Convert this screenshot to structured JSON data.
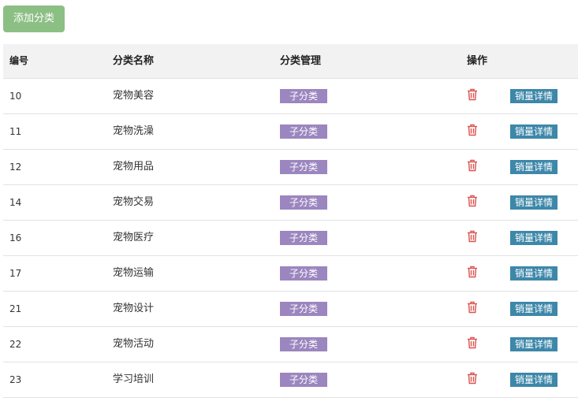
{
  "toolbar": {
    "add_label": "添加分类"
  },
  "table": {
    "headers": {
      "id": "编号",
      "name": "分类名称",
      "manage": "分类管理",
      "op": "操作"
    },
    "rows": [
      {
        "id": "10",
        "name": "宠物美容",
        "sub_label": "子分类",
        "sales_label": "销量详情"
      },
      {
        "id": "11",
        "name": "宠物洗澡",
        "sub_label": "子分类",
        "sales_label": "销量详情"
      },
      {
        "id": "12",
        "name": "宠物用品",
        "sub_label": "子分类",
        "sales_label": "销量详情"
      },
      {
        "id": "14",
        "name": "宠物交易",
        "sub_label": "子分类",
        "sales_label": "销量详情"
      },
      {
        "id": "16",
        "name": "宠物医疗",
        "sub_label": "子分类",
        "sales_label": "销量详情"
      },
      {
        "id": "17",
        "name": "宠物运输",
        "sub_label": "子分类",
        "sales_label": "销量详情"
      },
      {
        "id": "21",
        "name": "宠物设计",
        "sub_label": "子分类",
        "sales_label": "销量详情"
      },
      {
        "id": "22",
        "name": "宠物活动",
        "sub_label": "子分类",
        "sales_label": "销量详情"
      },
      {
        "id": "23",
        "name": "学习培训",
        "sub_label": "子分类",
        "sales_label": "销量详情"
      }
    ]
  },
  "icons": {
    "delete": "trash-icon"
  },
  "colors": {
    "add_button": "#8cbf84",
    "sub_badge": "#9b86bf",
    "sales_badge": "#3d87a9",
    "delete_icon": "#d9534f"
  }
}
